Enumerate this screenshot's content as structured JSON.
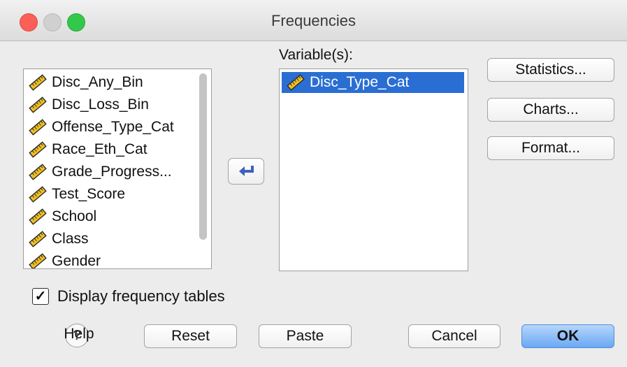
{
  "window": {
    "title": "Frequencies"
  },
  "source_list": {
    "items": [
      "Disc_Any_Bin",
      "Disc_Loss_Bin",
      "Offense_Type_Cat",
      "Race_Eth_Cat",
      "Grade_Progress...",
      "Test_Score",
      "School",
      "Class",
      "Gender"
    ],
    "icon": "ruler-pencil-icon"
  },
  "move_button": {
    "icon": "arrow-left-icon"
  },
  "variables": {
    "label": "Variable(s):",
    "items": [
      "Disc_Type_Cat"
    ],
    "selected_color": "#2b6ed3"
  },
  "buttons": {
    "statistics": "Statistics...",
    "charts": "Charts...",
    "format": "Format...",
    "reset": "Reset",
    "paste": "Paste",
    "cancel": "Cancel",
    "ok": "OK",
    "help": "Help"
  },
  "checkbox": {
    "label": "Display frequency tables",
    "checked": true,
    "mark": "✓"
  }
}
